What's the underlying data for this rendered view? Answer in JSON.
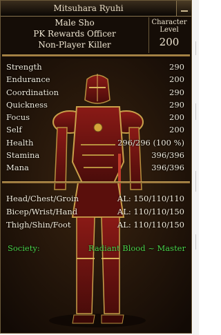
{
  "window": {
    "title": "Mitsuhara Ryuhi",
    "colors": {
      "panel": "#150d07",
      "border": "#c9a55d",
      "text": "#efe6d2",
      "society_text": "#49d14a"
    }
  },
  "character": {
    "gender_race": "Male Sho",
    "title": "PK Rewards Officer",
    "status": "Non-Player Killer",
    "level_label_line1": "Character",
    "level_label_line2": "Level",
    "level": "200"
  },
  "attributes": [
    {
      "name": "Strength",
      "value": "290"
    },
    {
      "name": "Endurance",
      "value": "200"
    },
    {
      "name": "Coordination",
      "value": "290"
    },
    {
      "name": "Quickness",
      "value": "290"
    },
    {
      "name": "Focus",
      "value": "200"
    },
    {
      "name": "Self",
      "value": "200"
    },
    {
      "name": "Health",
      "value": "296/296 (100 %)"
    },
    {
      "name": "Stamina",
      "value": "396/396"
    },
    {
      "name": "Mana",
      "value": "396/396"
    }
  ],
  "armor_levels": [
    {
      "slot": "Head/Chest/Groin",
      "value": "AL: 150/110/110"
    },
    {
      "slot": "Bicep/Wrist/Hand",
      "value": "AL: 110/110/150"
    },
    {
      "slot": "Thigh/Shin/Foot",
      "value": "AL: 110/110/150"
    }
  ],
  "society": {
    "label": "Society:",
    "value": "Radiant Blood ~ Master"
  },
  "icons": {
    "close": "minimize-icon",
    "avatar": "armored-character-avatar"
  }
}
